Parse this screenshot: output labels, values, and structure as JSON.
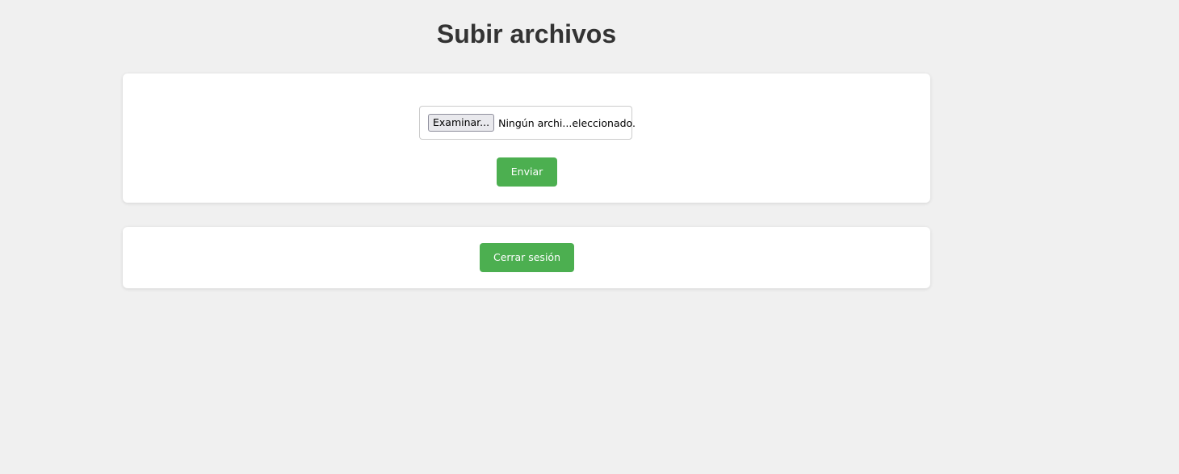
{
  "page": {
    "title": "Subir archivos"
  },
  "upload_form": {
    "browse_label": "Examinar...",
    "file_status": "Ningún archi...eleccionado.",
    "submit_label": "Enviar"
  },
  "session": {
    "logout_label": "Cerrar sesión"
  },
  "colors": {
    "background": "#f0f0f0",
    "card": "#ffffff",
    "button_primary": "#4caf50",
    "title_text": "#333333"
  }
}
